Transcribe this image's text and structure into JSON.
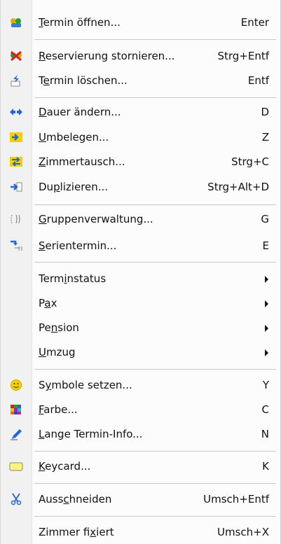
{
  "menu": {
    "items": [
      {
        "key": "open",
        "pre": "",
        "u": "T",
        "post": "ermin öffnen...",
        "shortcut": "Enter"
      },
      {
        "key": "cancel",
        "pre": "",
        "u": "R",
        "post": "eservierung stornieren...",
        "shortcut": "Strg+Entf"
      },
      {
        "key": "delete",
        "pre": "T",
        "u": "e",
        "post": "rmin löschen...",
        "shortcut": "Entf"
      },
      {
        "key": "duration",
        "pre": "",
        "u": "D",
        "post": "auer ändern...",
        "shortcut": "D"
      },
      {
        "key": "rebook",
        "pre": "",
        "u": "U",
        "post": "mbelegen...",
        "shortcut": "Z"
      },
      {
        "key": "swap",
        "pre": "",
        "u": "Z",
        "post": "immertausch...",
        "shortcut": "Strg+C"
      },
      {
        "key": "duplicate",
        "pre": "Du",
        "u": "p",
        "post": "lizieren...",
        "shortcut": "Strg+Alt+D"
      },
      {
        "key": "group",
        "pre": "",
        "u": "G",
        "post": "ruppenverwaltung...",
        "shortcut": "G"
      },
      {
        "key": "series",
        "pre": "",
        "u": "S",
        "post": "erientermin...",
        "shortcut": "E"
      },
      {
        "key": "status",
        "pre": "Term",
        "u": "i",
        "post": "nstatus",
        "shortcut": ""
      },
      {
        "key": "pax",
        "pre": "P",
        "u": "a",
        "post": "x",
        "shortcut": ""
      },
      {
        "key": "pension",
        "pre": "Pe",
        "u": "n",
        "post": "sion",
        "shortcut": ""
      },
      {
        "key": "move",
        "pre": "",
        "u": "U",
        "post": "mzug",
        "shortcut": ""
      },
      {
        "key": "symbols",
        "pre": "S",
        "u": "y",
        "post": "mbole setzen...",
        "shortcut": "Y"
      },
      {
        "key": "color",
        "pre": "",
        "u": "F",
        "post": "arbe...",
        "shortcut": "C"
      },
      {
        "key": "info",
        "pre": "",
        "u": "L",
        "post": "ange Termin-Info...",
        "shortcut": "N"
      },
      {
        "key": "keycard",
        "pre": "",
        "u": "K",
        "post": "eycard...",
        "shortcut": "K"
      },
      {
        "key": "cut",
        "pre": "Auss",
        "u": "c",
        "post": "hneiden",
        "shortcut": "Umsch+Entf"
      },
      {
        "key": "fixed",
        "pre": "Zimmer fi",
        "u": "x",
        "post": "iert",
        "shortcut": "Umsch+X"
      }
    ]
  },
  "icons": {
    "open": "calendar-people-icon",
    "cancel": "cross-people-icon",
    "delete": "delete-arrow-icon",
    "duration": "resize-arrows-icon",
    "rebook": "move-right-icon",
    "swap": "swap-icon",
    "duplicate": "duplicate-icon",
    "group": "group-brackets-icon",
    "series": "series-icon",
    "symbols": "smiley-icon",
    "color": "color-palette-icon",
    "info": "pen-icon",
    "keycard": "keycard-icon",
    "cut": "scissors-icon"
  }
}
